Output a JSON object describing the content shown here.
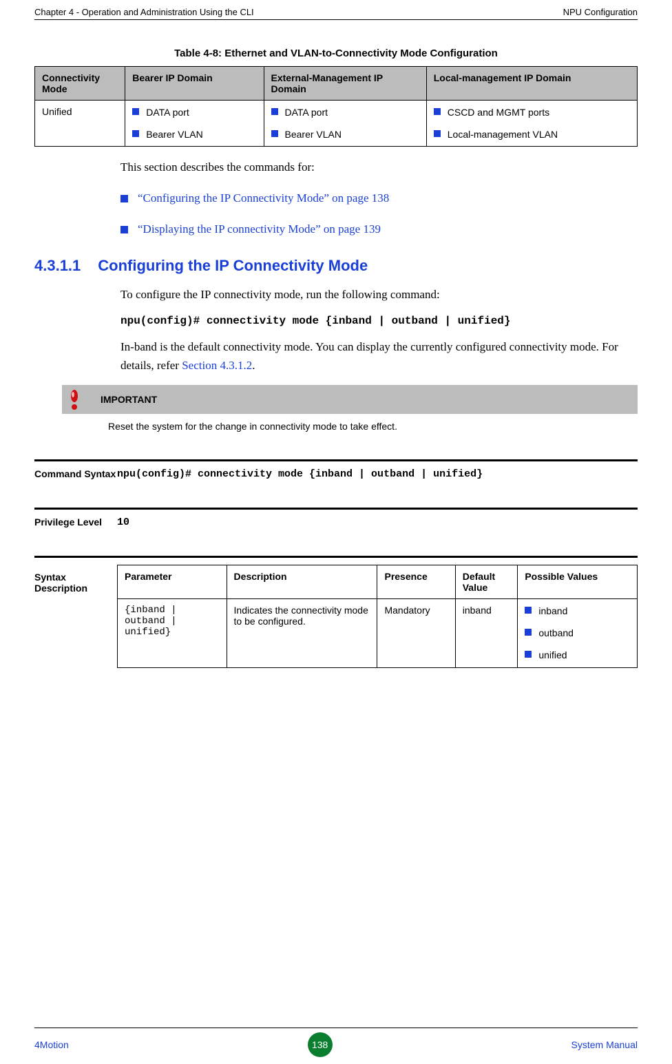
{
  "header": {
    "left": "Chapter 4 - Operation and Administration Using the CLI",
    "right": "NPU Configuration"
  },
  "table48": {
    "caption": "Table 4-8: Ethernet and VLAN-to-Connectivity Mode Configuration",
    "headers": {
      "c1": "Connectivity Mode",
      "c2": "Bearer IP Domain",
      "c3": "External-Management IP Domain",
      "c4": "Local-management IP Domain"
    },
    "row": {
      "c1": "Unified",
      "c2a": "DATA port",
      "c2b": "Bearer VLAN",
      "c3a": "DATA port",
      "c3b": "Bearer VLAN",
      "c4a": "CSCD and MGMT ports",
      "c4b": "Local-management VLAN"
    }
  },
  "intro": "This section describes the commands for:",
  "links": {
    "l1": "“Configuring the IP Connectivity Mode” on page 138",
    "l2": "“Displaying the IP connectivity Mode” on page 139"
  },
  "section": {
    "num": "4.3.1.1",
    "title": "Configuring the IP Connectivity Mode"
  },
  "para1": "To configure the IP connectivity mode, run the following command:",
  "command1": "npu(config)# connectivity mode {inband | outband | unified}",
  "para2_a": "In-band is the default connectivity mode. You can display the currently configured connectivity mode. For details, refer ",
  "para2_b": "Section 4.3.1.2",
  "para2_c": ".",
  "important": {
    "label": "IMPORTANT",
    "text": "Reset the system for the change in connectivity mode to take effect."
  },
  "cmdSyntax": {
    "label": "Command Syntax",
    "value": "npu(config)# connectivity mode {inband | outband | unified}"
  },
  "privLevel": {
    "label": "Privilege Level",
    "value": "10"
  },
  "syntaxDesc": {
    "label": "Syntax Description",
    "headers": {
      "h1": "Parameter",
      "h2": "Description",
      "h3": "Presence",
      "h4": "Default Value",
      "h5": "Possible Values"
    },
    "row": {
      "param": "{inband | outband | unified}",
      "desc": "Indicates the connectivity mode to be configured.",
      "presence": "Mandatory",
      "default": "inband",
      "pv1": "inband",
      "pv2": "outband",
      "pv3": "unified"
    }
  },
  "footer": {
    "left": "4Motion",
    "page": "138",
    "right": "System Manual"
  }
}
